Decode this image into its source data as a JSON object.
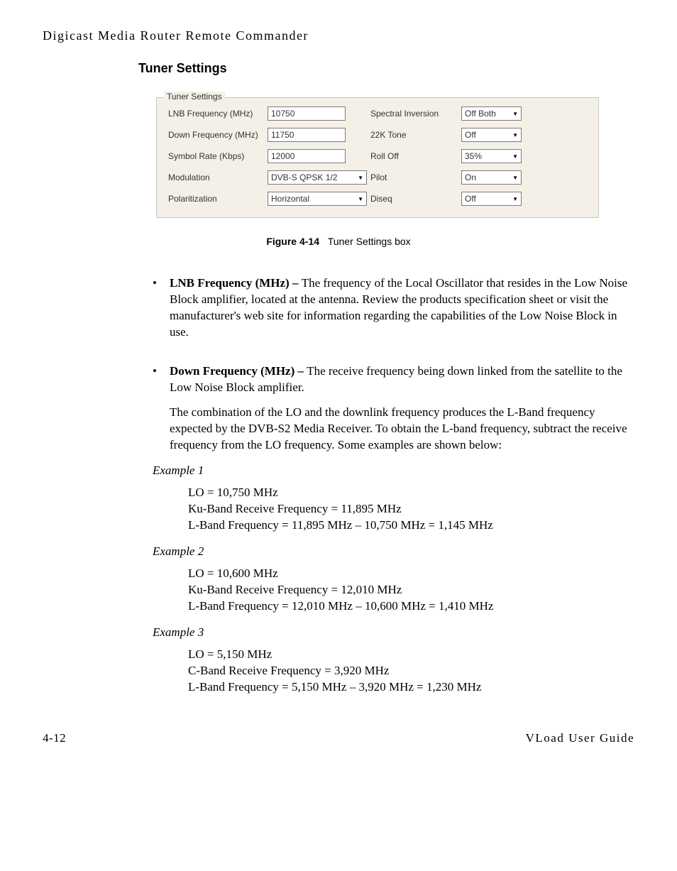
{
  "header": "Digicast Media Router Remote Commander",
  "section_title": "Tuner Settings",
  "settings": {
    "legend": "Tuner Settings",
    "rows": [
      {
        "l_label": "LNB Frequency (MHz)",
        "l_val": "10750",
        "l_type": "text",
        "r_label": "Spectral Inversion",
        "r_val": "Off Both"
      },
      {
        "l_label": "Down Frequency (MHz)",
        "l_val": "11750",
        "l_type": "text",
        "r_label": "22K Tone",
        "r_val": "Off"
      },
      {
        "l_label": "Symbol Rate (Kbps)",
        "l_val": "12000",
        "l_type": "text",
        "r_label": "Roll Off",
        "r_val": "35%"
      },
      {
        "l_label": "Modulation",
        "l_val": "DVB-S QPSK 1/2",
        "l_type": "drop",
        "r_label": "Pilot",
        "r_val": "On"
      },
      {
        "l_label": "Polaritization",
        "l_val": "Horizontal",
        "l_type": "drop",
        "r_label": "Diseq",
        "r_val": "Off"
      }
    ]
  },
  "figure": {
    "label": "Figure 4-14",
    "caption": "Tuner Settings box"
  },
  "bullets": {
    "lnb": {
      "term": "LNB Frequency (MHz) – ",
      "text": "The frequency of the Local Oscillator that resides in the Low Noise Block amplifier, located at the antenna.  Review the products specification sheet or visit the manufacturer's web site for information regarding the capabilities of the Low Noise Block in use."
    },
    "down": {
      "term": "Down Frequency (MHz) – ",
      "text": "The receive frequency being down linked from the satellite to the Low Noise Block amplifier."
    }
  },
  "combo_para": "The combination of the LO and the downlink frequency produces the L-Band frequency expected by the DVB-S2 Media Receiver. To obtain the L-band frequency, subtract the receive frequency from the LO frequency. Some examples are shown below:",
  "examples": [
    {
      "title": "Example 1",
      "lines": [
        "LO = 10,750 MHz",
        "Ku-Band Receive Frequency = 11,895 MHz",
        "L-Band Frequency = 11,895 MHz – 10,750 MHz = 1,145 MHz"
      ]
    },
    {
      "title": "Example 2",
      "lines": [
        "LO = 10,600 MHz",
        "Ku-Band Receive Frequency = 12,010 MHz",
        "L-Band Frequency = 12,010 MHz – 10,600 MHz = 1,410 MHz"
      ]
    },
    {
      "title": "Example 3",
      "lines": [
        "LO = 5,150 MHz",
        "C-Band Receive Frequency = 3,920 MHz",
        "L-Band Frequency = 5,150 MHz – 3,920 MHz = 1,230 MHz"
      ]
    }
  ],
  "footer": {
    "left": "4-12",
    "right": "VLoad User Guide"
  }
}
